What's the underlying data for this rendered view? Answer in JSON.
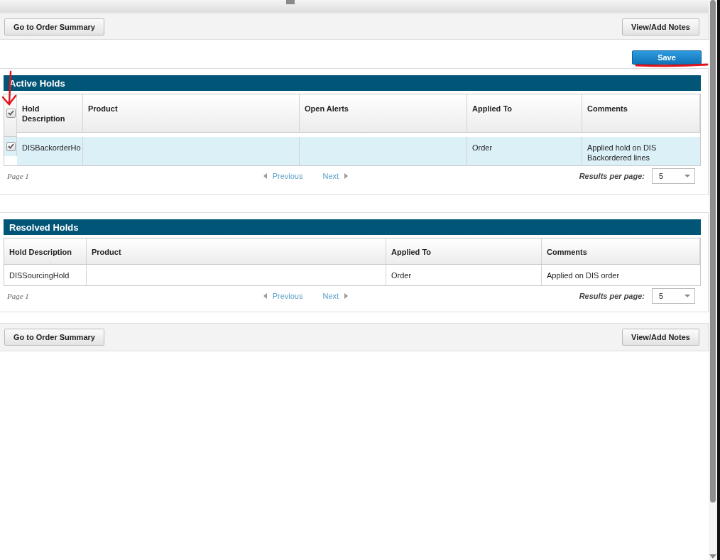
{
  "top_bar": {
    "buttons": [
      "Go to Order Summary",
      "View/Add Notes"
    ]
  },
  "save_button": "Save",
  "active_holds": {
    "title": "Active Holds",
    "select_all_checked": true,
    "columns": [
      "Hold Description",
      "Product",
      "Open Alerts",
      "Applied To",
      "Comments"
    ],
    "rows": [
      {
        "checked": true,
        "selected": true,
        "cells": [
          "DISBackorderHo",
          "",
          "",
          "Order",
          "Applied hold on DIS Backordered lines"
        ]
      }
    ],
    "pager": {
      "page": "Page 1",
      "previous": "Previous",
      "next": "Next",
      "results_label": "Results per page:",
      "results_value": "5"
    }
  },
  "resolved_holds": {
    "title": "Resolved Holds",
    "columns": [
      "Hold Description",
      "Product",
      "Applied To",
      "Comments"
    ],
    "rows": [
      {
        "selected": false,
        "cells": [
          "DISSourcingHold",
          "",
          "Order",
          "Applied on DIS order"
        ]
      }
    ],
    "pager": {
      "page": "Page 1",
      "previous": "Previous",
      "next": "Next",
      "results_label": "Results per page:",
      "results_value": "5"
    }
  },
  "bottom_bar": {
    "buttons": [
      "Go to Order Summary",
      "View/Add Notes"
    ]
  }
}
